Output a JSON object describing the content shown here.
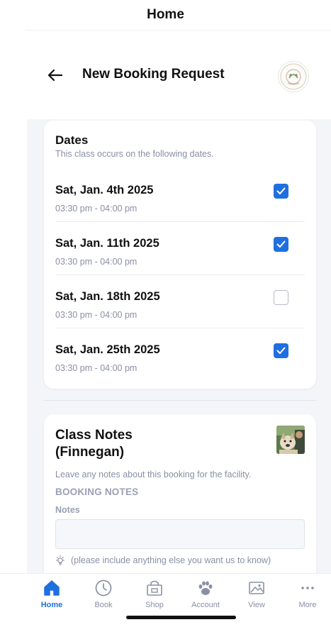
{
  "screen_title": "Home",
  "header": {
    "title": "New Booking Request"
  },
  "dates": {
    "title": "Dates",
    "subtitle": "This class occurs on the following dates.",
    "items": [
      {
        "date": "Sat, Jan. 4th 2025",
        "time": "03:30 pm - 04:00 pm",
        "checked": true
      },
      {
        "date": "Sat, Jan. 11th 2025",
        "time": "03:30 pm - 04:00 pm",
        "checked": true
      },
      {
        "date": "Sat, Jan. 18th 2025",
        "time": "03:30 pm - 04:00 pm",
        "checked": false
      },
      {
        "date": "Sat, Jan. 25th 2025",
        "time": "03:30 pm - 04:00 pm",
        "checked": true
      }
    ]
  },
  "notes": {
    "title_line1": "Class Notes",
    "title_line2": "(Finnegan)",
    "description": "Leave any notes about this booking for the facility.",
    "section_label": "BOOKING NOTES",
    "field_label": "Notes",
    "field_value": "",
    "hint": "(please include anything else you want us to know)"
  },
  "tabs": [
    {
      "label": "Home",
      "icon": "home-icon",
      "active": true
    },
    {
      "label": "Book",
      "icon": "clock-icon",
      "active": false
    },
    {
      "label": "Shop",
      "icon": "shop-icon",
      "active": false
    },
    {
      "label": "Account",
      "icon": "paw-icon",
      "active": false
    },
    {
      "label": "View",
      "icon": "image-icon",
      "active": false
    },
    {
      "label": "More",
      "icon": "more-icon",
      "active": false
    }
  ],
  "colors": {
    "accent": "#1f6fe0",
    "muted_text": "#8a8fa3",
    "page_bg": "#f4f5f9"
  }
}
